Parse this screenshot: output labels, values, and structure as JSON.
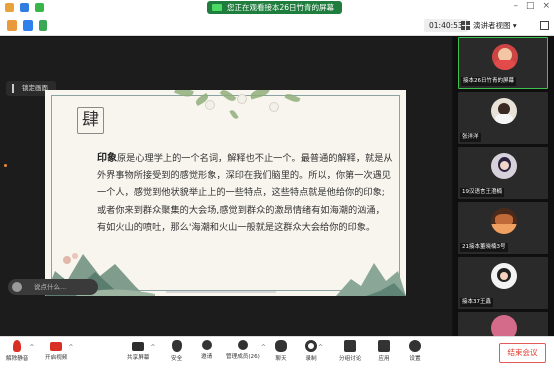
{
  "share_banner": {
    "text": "您正在观看接本26日竹青的屏幕"
  },
  "timer": "01:40:53",
  "view_button": "演讲者视图",
  "pin_tip": "锁定画面",
  "slide": {
    "chapter_char": "肆",
    "lead_word": "印象",
    "text_rest": "原是心理学上的一个名词，解释也不止一个。最普通的解释，就是从外界事物所接受到的感觉形象，深印在我们脑里的。所以，你第一次遇见一个人，感觉到他状貌举止上的一些特点，这些特点就是他给你的印象;或者你来到群众聚集的大会场,感觉到群众的激昂情绪有如海潮的汹涌，有如火山的喷吐，那么'海潮和火山一般就是这群众大会给你的印象。"
  },
  "chat_placeholder": "说点什么...",
  "participants": [
    {
      "label": "接本26日竹青的屏幕"
    },
    {
      "label": "张洋洋"
    },
    {
      "label": "19汉语言王澄楠"
    },
    {
      "label": "21接本董晓楠3号"
    },
    {
      "label": "接本37王鑫"
    },
    {
      "label": ""
    }
  ],
  "toolbar": {
    "unmute": "解除静音",
    "start_video": "开启视频",
    "share": "共享屏幕",
    "security": "安全",
    "invite": "邀请",
    "manage": "管理成员(26)",
    "chat": "聊天",
    "record": "录制",
    "breakout": "分组讨论",
    "apps": "应用",
    "settings": "设置",
    "end": "结束会议"
  },
  "colors": {
    "share_green": "#1f7d3e",
    "end_red": "#e0392b",
    "active_border": "#3ec14f"
  }
}
